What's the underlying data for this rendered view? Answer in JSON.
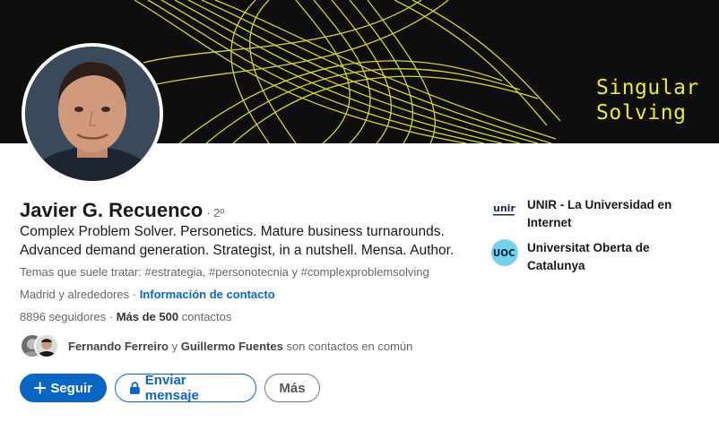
{
  "banner": {
    "line1": "Singular",
    "line2": "Solving",
    "accent": "#ece83a"
  },
  "profile": {
    "name": "Javier G. Recuenco",
    "degree": "· 2º",
    "headline": "Complex Problem Solver. Personetics. Mature business turnarounds. Advanced demand generation. Strategist, in a nutshell. Mensa. Author.",
    "topics": "Temas que suele tratar: #estrategia, #personotecnia y #complexproblemsolving",
    "location": "Madrid y alrededores",
    "location_sep": " · ",
    "contact_link": "Información de contacto",
    "followers": "8896 seguidores",
    "stats_sep": " · ",
    "connections_bold": "Más de 500",
    "connections_rest": " contactos"
  },
  "mutual": {
    "name1": "Fernando Ferreiro",
    "connector": " y ",
    "name2": "Guillermo Fuentes",
    "suffix": " son contactos en común"
  },
  "actions": {
    "follow": "Seguir",
    "message": "Enviar mensaje",
    "more": "Más"
  },
  "education": [
    {
      "logo": "unir-logo",
      "logo_text": "unir",
      "name": "UNIR - La Universidad en Internet"
    },
    {
      "logo": "uoc-logo",
      "logo_text": "UOC",
      "name": "Universitat Oberta de Catalunya"
    }
  ],
  "colors": {
    "brand_blue": "#0a66c2",
    "banner_bg": "#0e0e0e"
  }
}
